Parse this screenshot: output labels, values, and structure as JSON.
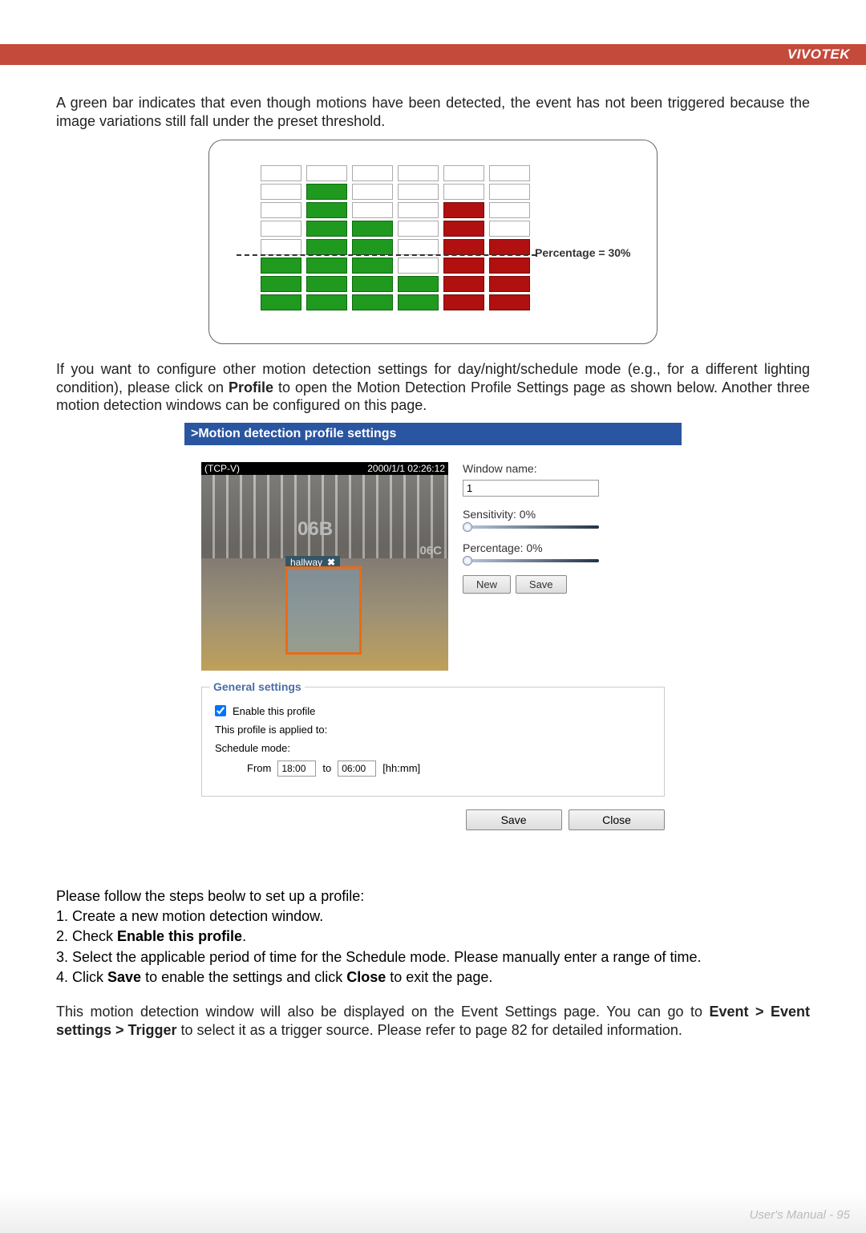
{
  "brand": "VIVOTEK",
  "para1": "A green bar indicates that even though motions have been detected, the event has not been triggered because the image variations still fall under the preset threshold.",
  "chart_data": {
    "type": "bar",
    "threshold_label": "Percentage = 30%",
    "threshold_value": 30,
    "columns": [
      {
        "fill": 3,
        "color": "green"
      },
      {
        "fill": 7,
        "color": "green"
      },
      {
        "fill": 5,
        "color": "green"
      },
      {
        "fill": 2,
        "color": "green"
      },
      {
        "fill": 6,
        "color": "red"
      },
      {
        "fill": 4,
        "color": "red"
      }
    ],
    "col_height": 8
  },
  "para2_a": "If you want to configure other motion detection settings for day/night/schedule mode (e.g., for a different lighting condition), please click on ",
  "para2_b_bold": "Profile",
  "para2_c": " to open the Motion Detection Profile Settings page as shown below. Another three motion detection windows can be configured on this page.",
  "panel": {
    "title": ">Motion detection profile settings",
    "overlay_left": "(TCP-V)",
    "overlay_right": "2000/1/1 02:26:12",
    "hall_region": "hallway",
    "ptx1": "06B",
    "ptx2": "06C",
    "window_name_label": "Window name:",
    "window_name_value": "1",
    "sensitivity_label": "Sensitivity: 0%",
    "percentage_label": "Percentage: 0%",
    "new_btn": "New",
    "save_btn": "Save"
  },
  "general": {
    "legend": "General settings",
    "enable_label": "Enable this profile",
    "applied_label": "This profile is applied to:",
    "schedule_label": "Schedule mode:",
    "from_label": "From",
    "from_value": "18:00",
    "to_label": "to",
    "to_value": "06:00",
    "fmt": "[hh:mm]",
    "save_btn": "Save",
    "close_btn": "Close"
  },
  "steps": {
    "intro": "Please follow the steps beolw to set up a profile:",
    "s1": "1. Create a new motion detection window.",
    "s2a": "2. Check ",
    "s2b_bold": "Enable this profile",
    "s2c": ".",
    "s3": "3. Select the applicable period of time for the Schedule mode. Please manually enter a range of time.",
    "s4a": "4. Click ",
    "s4b_bold": "Save",
    "s4c": " to enable the settings and click ",
    "s4d_bold": "Close",
    "s4e": " to exit the page."
  },
  "closing_a": "This motion detection window will also be displayed on the Event Settings page. You can go to ",
  "closing_b_bold": "Event > Event settings > Trigger",
  "closing_c": " to select it as a trigger source. Please refer to page 82 for detailed information.",
  "footer": "User's Manual - 95"
}
